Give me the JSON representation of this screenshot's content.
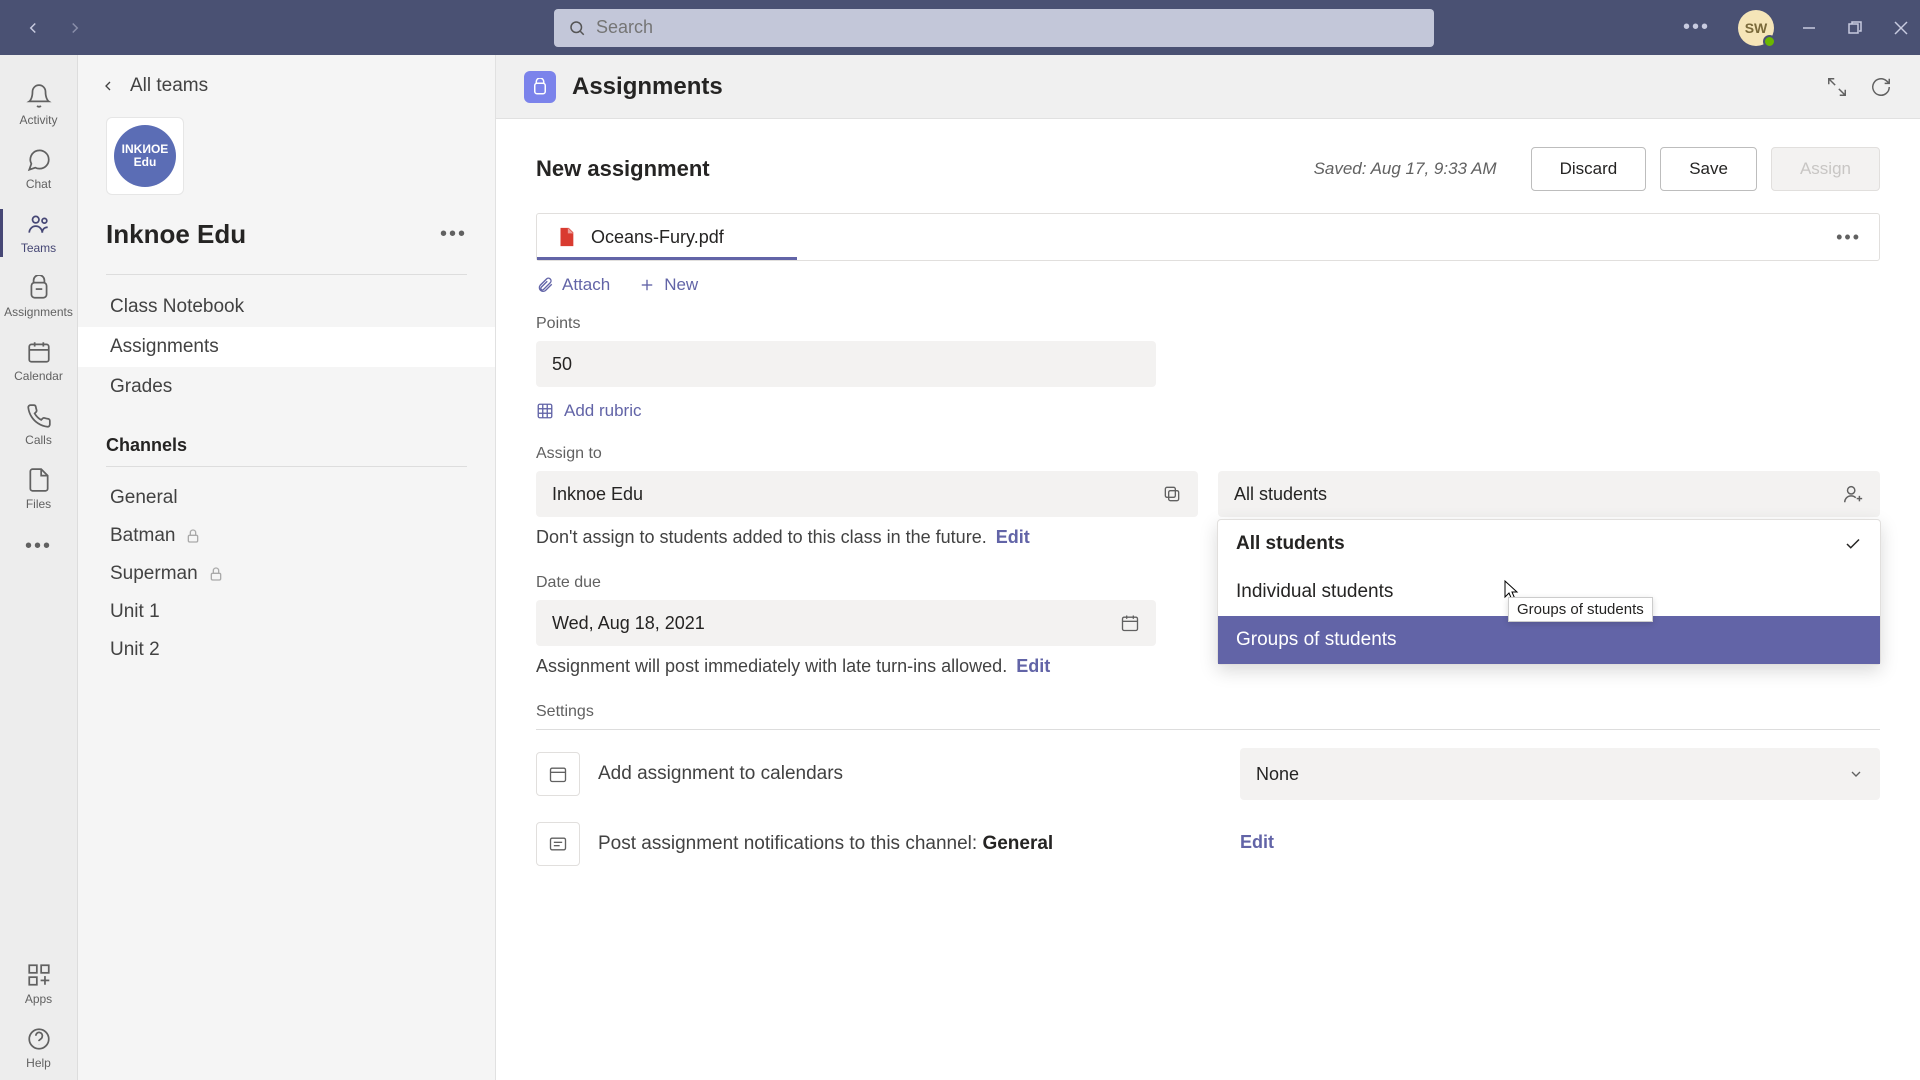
{
  "titlebar": {
    "search_placeholder": "Search",
    "avatar_initials": "SW"
  },
  "rail": {
    "items": [
      {
        "label": "Activity"
      },
      {
        "label": "Chat"
      },
      {
        "label": "Teams"
      },
      {
        "label": "Assignments"
      },
      {
        "label": "Calendar"
      },
      {
        "label": "Calls"
      },
      {
        "label": "Files"
      }
    ],
    "apps_label": "Apps",
    "help_label": "Help"
  },
  "sidebar": {
    "back_label": "All teams",
    "team_logo_text_top": "INKИOE",
    "team_logo_text_bottom": "Edu",
    "team_name": "Inknoe Edu",
    "links": [
      {
        "label": "Class Notebook"
      },
      {
        "label": "Assignments"
      },
      {
        "label": "Grades"
      }
    ],
    "channels_heading": "Channels",
    "channels": [
      {
        "label": "General",
        "private": false
      },
      {
        "label": "Batman",
        "private": true
      },
      {
        "label": "Superman",
        "private": true
      },
      {
        "label": "Unit 1",
        "private": false
      },
      {
        "label": "Unit 2",
        "private": false
      }
    ]
  },
  "main": {
    "app_title": "Assignments",
    "page_title": "New assignment",
    "saved_text": "Saved: Aug 17, 9:33 AM",
    "discard_label": "Discard",
    "save_label": "Save",
    "assign_label": "Assign",
    "attachment_name": "Oceans-Fury.pdf",
    "attach_label": "Attach",
    "new_label": "New",
    "points_label": "Points",
    "points_value": "50",
    "add_rubric_label": "Add rubric",
    "assign_to_label": "Assign to",
    "class_value": "Inknoe Edu",
    "students_value": "All students",
    "dropdown": {
      "opt_all": "All students",
      "opt_individual": "Individual students",
      "opt_groups": "Groups of students"
    },
    "tooltip_text": "Groups of students",
    "future_hint": "Don't assign to students added to this class in the future.",
    "edit_label": "Edit",
    "date_due_label": "Date due",
    "date_due_value": "Wed, Aug 18, 2021",
    "post_hint": "Assignment will post immediately with late turn-ins allowed.",
    "settings_label": "Settings",
    "calendar_text": "Add assignment to calendars",
    "calendar_select": "None",
    "notify_text_prefix": "Post assignment notifications to this channel: ",
    "notify_channel": "General"
  }
}
